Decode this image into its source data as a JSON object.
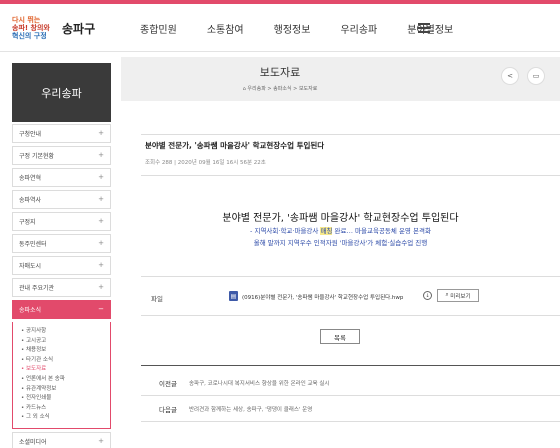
{
  "header": {
    "logo_line1": "다시 뛰는",
    "logo_line2": "송파! 창의와",
    "logo_line3": "혁신의 구정",
    "brand": "송파구",
    "menu": [
      "종합민원",
      "소통참여",
      "행정정보",
      "우리송파",
      "분야별정보"
    ],
    "menu_icon": "hamburger-icon"
  },
  "sidebar": {
    "title": "우리송파",
    "items": [
      {
        "label": "구청안내"
      },
      {
        "label": "구정 기본현황"
      },
      {
        "label": "송파연혁"
      },
      {
        "label": "송파역사"
      },
      {
        "label": "구정지"
      },
      {
        "label": "동주민센터"
      },
      {
        "label": "자매도시"
      },
      {
        "label": "관내 주요기관"
      },
      {
        "label": "송파소식"
      }
    ],
    "active_index": 8,
    "submenu": [
      "공지사항",
      "고시공고",
      "채용정보",
      "타기관 소식",
      "보도자료",
      "언론에서 본 송파",
      "유관계약정보",
      "전자인쇄물",
      "카드뉴스",
      "그 외 소식"
    ],
    "submenu_current": 4,
    "last_item": "소셜미디어",
    "accent_color": "#e24a6b"
  },
  "page": {
    "title": "보도자료",
    "breadcrumb": "⌂ 우리송파 > 송파소식 > 보도자료",
    "share_icon": "share-icon",
    "print_icon": "print-icon"
  },
  "post": {
    "title": "분야별 전문가, '송파쌤 마을강사' 학교현장수업 투입된다",
    "meta": "조회수 288  |  2020년 09월 16일 16시 56분 22초",
    "headline": "분야별 전문가, '송파쌤 마을강사' 학교현장수업 투입된다",
    "sub1_before": "- 지역사회·학교·마을강사 ",
    "sub1_highlight": "매칭",
    "sub1_after": " 완료… 마을교육공동체 운영 본격화",
    "sub2": "올해 말까지 지역우수 인적자원 '마을강사'가 체험·실습수업 진행"
  },
  "attachment": {
    "label": "파일",
    "filename": "(0916)분야별 전문가, '송파쌤 마을강사' 학교현장수업 투입된다.hwp",
    "preview_label": "미리보기"
  },
  "actions": {
    "list_label": "목록"
  },
  "navigation": {
    "prev_label": "이전글",
    "prev_text": "송파구, 코로나시대 복지서비스 향상을 위한 온라인 교육 실시",
    "next_label": "다음글",
    "next_text": "반려견과 함께하는 세상, 송파구, '댕댕이 클래스' 운영"
  }
}
